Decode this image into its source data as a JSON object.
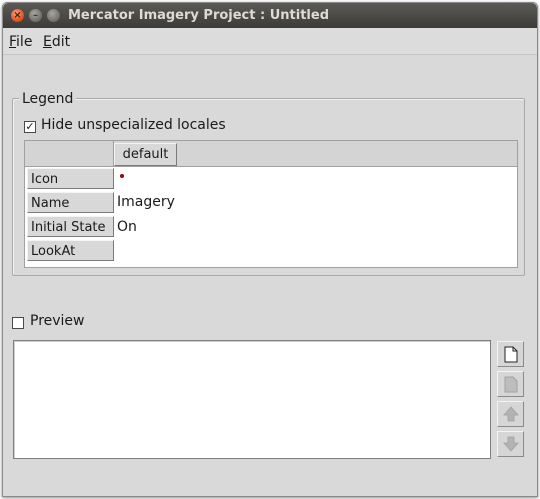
{
  "window": {
    "title": "Mercator Imagery Project : Untitled",
    "buttons": [
      "close-icon",
      "minimize-icon",
      "maximize-icon"
    ]
  },
  "menu": {
    "file": {
      "mnemonic": "F",
      "rest": "ile"
    },
    "edit": {
      "mnemonic": "E",
      "rest": "dit"
    }
  },
  "legend": {
    "title": "Legend",
    "hide_unspecialized": {
      "label": "Hide unspecialized locales",
      "checked": true,
      "mark": "☑"
    },
    "table": {
      "column_header": "default",
      "rows": [
        {
          "label": "Icon",
          "value": ""
        },
        {
          "label": "Name",
          "value": "Imagery"
        },
        {
          "label": "Initial State",
          "value": "On"
        },
        {
          "label": "LookAt",
          "value": ""
        }
      ],
      "icon_color": "#8b0b0b"
    }
  },
  "preview": {
    "label": "Preview",
    "checked": false,
    "buttons": [
      "new-document-icon",
      "document-icon",
      "arrow-up-icon",
      "arrow-down-icon"
    ]
  }
}
